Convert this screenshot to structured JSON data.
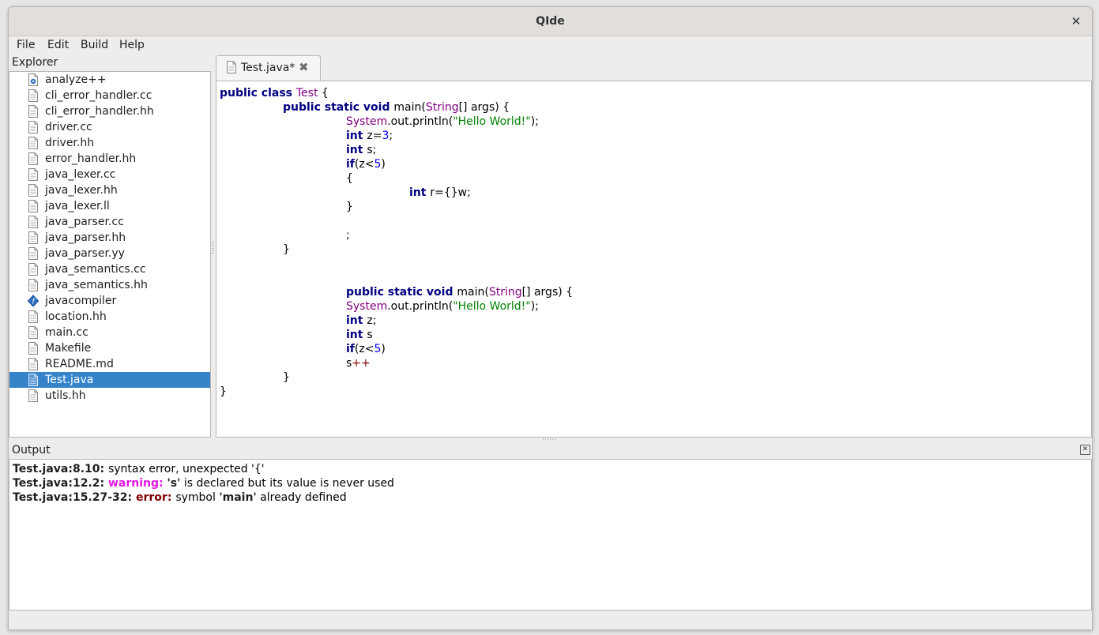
{
  "window": {
    "title": "QIde",
    "close_glyph": "✕"
  },
  "menu": [
    "File",
    "Edit",
    "Build",
    "Help"
  ],
  "explorer": {
    "label": "Explorer",
    "selected": "Test.java",
    "files": [
      {
        "name": "analyze++",
        "icon": "executable-script-icon"
      },
      {
        "name": "cli_error_handler.cc",
        "icon": "text-file-icon"
      },
      {
        "name": "cli_error_handler.hh",
        "icon": "text-file-icon"
      },
      {
        "name": "driver.cc",
        "icon": "text-file-icon"
      },
      {
        "name": "driver.hh",
        "icon": "text-file-icon"
      },
      {
        "name": "error_handler.hh",
        "icon": "text-file-icon"
      },
      {
        "name": "java_lexer.cc",
        "icon": "text-file-icon"
      },
      {
        "name": "java_lexer.hh",
        "icon": "text-file-icon"
      },
      {
        "name": "java_lexer.ll",
        "icon": "text-file-icon"
      },
      {
        "name": "java_parser.cc",
        "icon": "text-file-icon"
      },
      {
        "name": "java_parser.hh",
        "icon": "text-file-icon"
      },
      {
        "name": "java_parser.yy",
        "icon": "text-file-icon"
      },
      {
        "name": "java_semantics.cc",
        "icon": "text-file-icon"
      },
      {
        "name": "java_semantics.hh",
        "icon": "text-file-icon"
      },
      {
        "name": "javacompiler",
        "icon": "executable-icon"
      },
      {
        "name": "location.hh",
        "icon": "text-file-icon"
      },
      {
        "name": "main.cc",
        "icon": "text-file-icon"
      },
      {
        "name": "Makefile",
        "icon": "text-file-icon"
      },
      {
        "name": "README.md",
        "icon": "text-file-icon"
      },
      {
        "name": "Test.java",
        "icon": "text-file-icon"
      },
      {
        "name": "utils.hh",
        "icon": "text-file-icon"
      }
    ]
  },
  "editor": {
    "tab_label": "Test.java*",
    "tab_close_glyph": "✖",
    "code": [
      {
        "indent": 0,
        "tokens": [
          [
            "kw",
            "public class "
          ],
          [
            "ty",
            "Test"
          ],
          [
            "plain",
            " {"
          ]
        ]
      },
      {
        "indent": 1,
        "tokens": [
          [
            "kw",
            "public static void "
          ],
          [
            "plain",
            "main("
          ],
          [
            "ty",
            "String"
          ],
          [
            "plain",
            "[] args) {"
          ]
        ]
      },
      {
        "indent": 2,
        "tokens": [
          [
            "ty",
            "System"
          ],
          [
            "plain",
            ".out.println("
          ],
          [
            "str",
            "\"Hello World!\""
          ],
          [
            "plain",
            ");"
          ]
        ]
      },
      {
        "indent": 2,
        "tokens": [
          [
            "kw",
            "int "
          ],
          [
            "plain",
            "z="
          ],
          [
            "num",
            "3"
          ],
          [
            "plain",
            ";"
          ]
        ]
      },
      {
        "indent": 2,
        "tokens": [
          [
            "kw",
            "int "
          ],
          [
            "plain",
            "s;"
          ]
        ]
      },
      {
        "indent": 2,
        "tokens": [
          [
            "kw",
            "if"
          ],
          [
            "plain",
            "(z<"
          ],
          [
            "num",
            "5"
          ],
          [
            "plain",
            ")"
          ]
        ]
      },
      {
        "indent": 2,
        "tokens": [
          [
            "plain",
            "{"
          ]
        ]
      },
      {
        "indent": 3,
        "tokens": [
          [
            "kw",
            "int "
          ],
          [
            "plain",
            "r={}w;"
          ]
        ]
      },
      {
        "indent": 2,
        "tokens": [
          [
            "plain",
            "}"
          ]
        ]
      },
      {
        "indent": 2,
        "tokens": []
      },
      {
        "indent": 2,
        "tokens": [
          [
            "plain",
            ";"
          ]
        ]
      },
      {
        "indent": 1,
        "tokens": [
          [
            "plain",
            "}"
          ]
        ]
      },
      {
        "indent": 1,
        "tokens": []
      },
      {
        "indent": 1,
        "tokens": []
      },
      {
        "indent": 2,
        "tokens": [
          [
            "kw",
            "public static void "
          ],
          [
            "plain",
            "main("
          ],
          [
            "ty",
            "String"
          ],
          [
            "plain",
            "[] args) {"
          ]
        ]
      },
      {
        "indent": 2,
        "tokens": [
          [
            "ty",
            "System"
          ],
          [
            "plain",
            ".out.println("
          ],
          [
            "str",
            "\"Hello World!\""
          ],
          [
            "plain",
            ");"
          ]
        ]
      },
      {
        "indent": 2,
        "tokens": [
          [
            "kw",
            "int "
          ],
          [
            "plain",
            "z;"
          ]
        ]
      },
      {
        "indent": 2,
        "tokens": [
          [
            "kw",
            "int "
          ],
          [
            "plain",
            "s"
          ]
        ]
      },
      {
        "indent": 2,
        "tokens": [
          [
            "kw",
            "if"
          ],
          [
            "plain",
            "(z<"
          ],
          [
            "num",
            "5"
          ],
          [
            "plain",
            ")"
          ]
        ]
      },
      {
        "indent": 2,
        "tokens": [
          [
            "plain",
            "s"
          ],
          [
            "op",
            "++"
          ]
        ]
      },
      {
        "indent": 1,
        "tokens": [
          [
            "plain",
            "}"
          ]
        ]
      },
      {
        "indent": 0,
        "tokens": [
          [
            "plain",
            "}"
          ]
        ]
      }
    ]
  },
  "output": {
    "label": "Output",
    "close_glyph": "✕",
    "lines": [
      [
        [
          "b",
          "Test.java:8.10: "
        ],
        [
          "plain",
          "syntax error, unexpected '{'"
        ]
      ],
      [
        [
          "b",
          "Test.java:12.2: "
        ],
        [
          "warn",
          "warning: "
        ],
        [
          "b",
          "'s'"
        ],
        [
          "plain",
          " is declared but its value is never used"
        ]
      ],
      [
        [
          "b",
          "Test.java:15.27-32: "
        ],
        [
          "err",
          "error: "
        ],
        [
          "plain",
          "symbol "
        ],
        [
          "b",
          "'main'"
        ],
        [
          "plain",
          " already defined"
        ]
      ]
    ]
  },
  "colors": {
    "keyword": "#000080",
    "type": "#800080",
    "string": "#008000",
    "number": "#0000ff",
    "operator": "#800000",
    "warning": "#e317e3",
    "error": "#800000",
    "selection": "#3584c9"
  }
}
